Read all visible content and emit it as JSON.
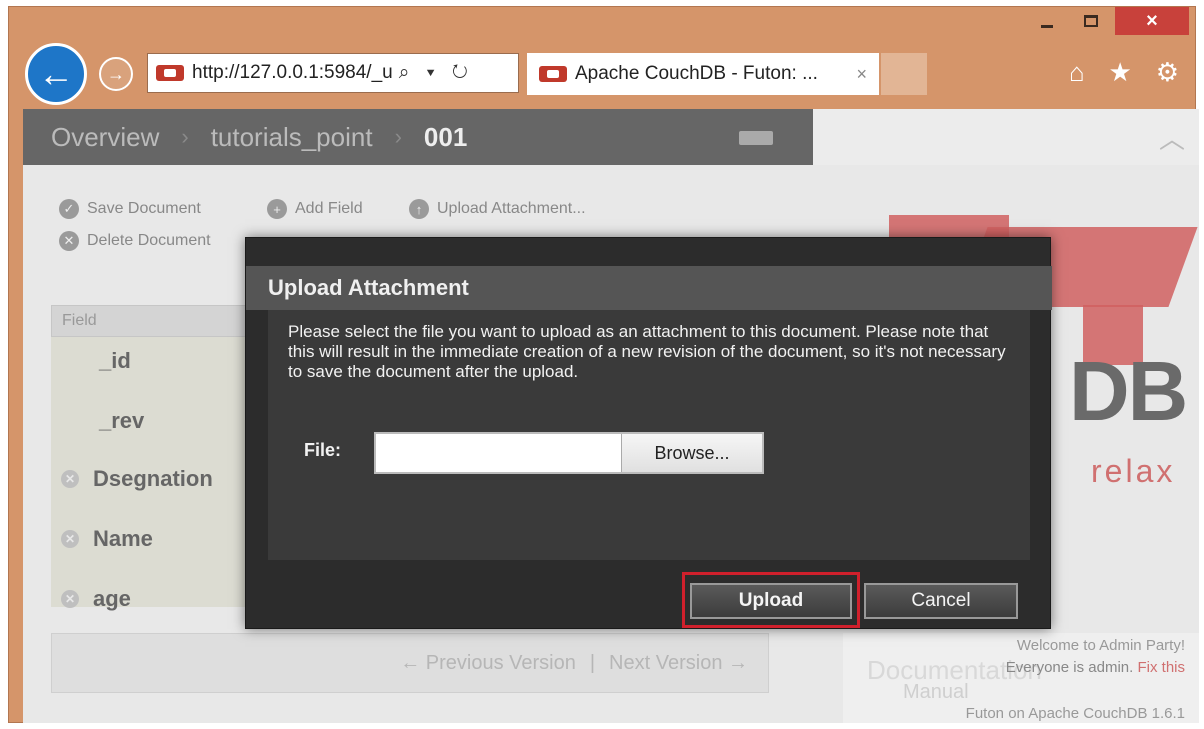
{
  "browser": {
    "address": "http://127.0.0.1:5984/_u",
    "address_tools": "⌕ ▾ ↻",
    "tab_title": "Apache CouchDB - Futon: ...",
    "tab_close": "×",
    "win_close": "×"
  },
  "breadcrumb": {
    "items": [
      "Overview",
      "tutorials_point",
      "001"
    ],
    "sep": "›"
  },
  "toolbar": {
    "save": "Save Document",
    "add_field": "Add Field",
    "upload": "Upload Attachment...",
    "delete": "Delete Document"
  },
  "fields": {
    "header": "Field",
    "rows": [
      "_id",
      "_rev",
      "Dsegnation",
      "Name",
      "age"
    ]
  },
  "pager": {
    "prev": "← Previous Version",
    "sep": "|",
    "next": "Next Version →"
  },
  "logo": {
    "db": "DB",
    "relax": "relax"
  },
  "footer": {
    "documentation": "Documentation",
    "manual": "Manual",
    "welcome": "Welcome to Admin Party!",
    "admin_text": "Everyone is admin.",
    "fix": "Fix this",
    "version": "Futon on Apache CouchDB 1.6.1"
  },
  "dialog": {
    "title": "Upload Attachment",
    "message": "Please select the file you want to upload as an attachment to this document. Please note that this will result in the immediate creation of a new revision of the document, so it's not necessary to save the document after the upload.",
    "file_label": "File:",
    "browse": "Browse...",
    "upload": "Upload",
    "cancel": "Cancel"
  },
  "colors": {
    "window_frame": "#d5956a",
    "back_button": "#1e76c8",
    "highlight": "#d0202c",
    "couchdb_red": "#d06060"
  }
}
